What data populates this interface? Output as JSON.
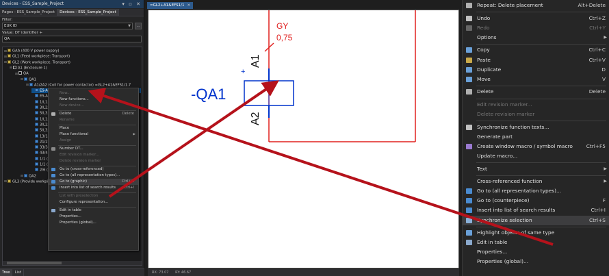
{
  "panel": {
    "title": "Devices - ESS_Sample_Project",
    "tabs": [
      "Pages - ESS_Sample_Project",
      "Devices - ESS_Sample_Project"
    ],
    "filter_label": "Filter:",
    "filter_value": "EUK ID",
    "value_label": "Value: DT identifier +",
    "search_value": "QA",
    "bottom_tabs": [
      "Tree",
      "List"
    ]
  },
  "tree": [
    {
      "text": "GAA (400 V power supply)",
      "indent": 0,
      "icon": "yellow"
    },
    {
      "text": "GL1 (Feed workpiece: Transport)",
      "indent": 0,
      "icon": "yellow"
    },
    {
      "text": "GL2 (Work workpiece: Transport)",
      "indent": 0,
      "icon": "yellow"
    },
    {
      "text": "A1 (Enclosure 1)",
      "indent": 1,
      "icon": "box"
    },
    {
      "text": "QA",
      "indent": 2,
      "icon": "box"
    },
    {
      "text": "QA1",
      "indent": 3,
      "icon": "blue"
    },
    {
      "text": "A1/2A2 (Coil for power contactor) =GL2+A1&EFS1/1.7",
      "indent": 4,
      "icon": "blue"
    },
    {
      "text": "ES-A1",
      "indent": 5,
      "icon": "blue",
      "selected": true
    },
    {
      "text": "ES-A2",
      "indent": 5,
      "icon": "blue"
    },
    {
      "text": "1/L1;",
      "indent": 5,
      "icon": "blue"
    },
    {
      "text": "3/L2;",
      "indent": 5,
      "icon": "blue"
    },
    {
      "text": "5/L3;",
      "indent": 5,
      "icon": "blue"
    },
    {
      "text": "1/L1;4/",
      "indent": 5,
      "icon": "blue"
    },
    {
      "text": "3/L2;4/",
      "indent": 5,
      "icon": "blue"
    },
    {
      "text": "5/L3;6/",
      "indent": 5,
      "icon": "blue"
    },
    {
      "text": "13/14 (",
      "indent": 5,
      "icon": "blue"
    },
    {
      "text": "21/22 (",
      "indent": 5,
      "icon": "blue"
    },
    {
      "text": "33/34 (",
      "indent": 5,
      "icon": "blue"
    },
    {
      "text": "43/44 (",
      "indent": 5,
      "icon": "blue"
    },
    {
      "text": "1/1 (Ma",
      "indent": 5,
      "icon": "blue"
    },
    {
      "text": "1/1 (M",
      "indent": 5,
      "icon": "blue"
    },
    {
      "text": "2/6 (Ma",
      "indent": 5,
      "icon": "blue"
    },
    {
      "text": "QA2",
      "indent": 3,
      "icon": "blue"
    },
    {
      "text": "GL3 (Provide workpie",
      "indent": 0,
      "icon": "yellow"
    }
  ],
  "small_menu": [
    {
      "label": "New...",
      "disabled": true
    },
    {
      "label": "New functions...",
      "disabled": false
    },
    {
      "label": "New device...",
      "disabled": true
    },
    {
      "sep": true
    },
    {
      "label": "Delete",
      "shortcut": "Delete",
      "icon": "trash"
    },
    {
      "label": "Rename",
      "disabled": true
    },
    {
      "sep": true
    },
    {
      "label": "Place"
    },
    {
      "label": "Place functional",
      "submenu": true
    },
    {
      "label": "Assign",
      "disabled": true
    },
    {
      "sep": true
    },
    {
      "label": "Number DT...",
      "icon": "num"
    },
    {
      "label": "Edit revision marker...",
      "disabled": true
    },
    {
      "label": "Delete revision marker",
      "disabled": true
    },
    {
      "sep": true
    },
    {
      "label": "Go to (cross-referenced)",
      "icon": "goto"
    },
    {
      "label": "Go to (all representation types)...",
      "icon": "goto"
    },
    {
      "label": "Go to (graphic)",
      "shortcut": "Ctrl+G",
      "icon": "goto",
      "highlight": true
    },
    {
      "label": "Insert into list of search results",
      "shortcut": "Ctrl+I",
      "icon": "list"
    },
    {
      "sep": true
    },
    {
      "label": "List with preselection",
      "disabled": true
    },
    {
      "label": "Configure representation..."
    },
    {
      "sep": true
    },
    {
      "label": "Edit in table",
      "icon": "table"
    },
    {
      "label": "Properties..."
    },
    {
      "label": "Properties (global)..."
    }
  ],
  "doc_tab": "=GL2+A1&EFS1/1",
  "schematic": {
    "device_tag": "-QA1",
    "pin_top": "A1",
    "pin_bottom": "A2",
    "plus_sign": "+",
    "wire_color": "GY",
    "wire_size": "0,75"
  },
  "status": [
    "RX: 73.07",
    "RY: 46.67"
  ],
  "large_menu": [
    {
      "label": "Repeat: Delete placement",
      "shortcut": "Alt+Delete",
      "icon": "repeat"
    },
    {
      "sep": true
    },
    {
      "label": "Undo",
      "shortcut": "Ctrl+Z",
      "icon": "undo"
    },
    {
      "label": "Redo",
      "shortcut": "Ctrl+Y",
      "icon": "redo",
      "disabled": true
    },
    {
      "label": "Options",
      "submenu": true
    },
    {
      "sep": true
    },
    {
      "label": "Copy",
      "shortcut": "Ctrl+C",
      "icon": "copy"
    },
    {
      "label": "Paste",
      "shortcut": "Ctrl+V",
      "icon": "paste"
    },
    {
      "label": "Duplicate",
      "shortcut": "D",
      "icon": "dup"
    },
    {
      "label": "Move",
      "shortcut": "V",
      "icon": "move"
    },
    {
      "sep": true
    },
    {
      "label": "Delete",
      "shortcut": "Delete",
      "icon": "trash"
    },
    {
      "sep": true
    },
    {
      "label": "Edit revision marker...",
      "disabled": true
    },
    {
      "label": "Delete revision marker",
      "disabled": true
    },
    {
      "sep": true
    },
    {
      "label": "Synchronize function texts...",
      "icon": "synctext"
    },
    {
      "label": "Generate part"
    },
    {
      "label": "Create window macro / symbol macro",
      "shortcut": "Ctrl+F5",
      "icon": "macro"
    },
    {
      "label": "Update macro..."
    },
    {
      "sep": true
    },
    {
      "label": "Text",
      "submenu": true
    },
    {
      "sep": true
    },
    {
      "label": "Cross-referenced function",
      "submenu": true
    },
    {
      "label": "Go to (all representation types)...",
      "icon": "goto"
    },
    {
      "label": "Go to (counterpiece)",
      "shortcut": "F",
      "icon": "goto"
    },
    {
      "label": "Insert into list of search results",
      "shortcut": "Ctrl+I",
      "icon": "list"
    },
    {
      "label": "Synchronize selection",
      "shortcut": "Ctrl+S",
      "icon": "sync",
      "highlight": true
    },
    {
      "sep": true
    },
    {
      "label": "Highlight objects of same type",
      "icon": "highlight"
    },
    {
      "label": "Edit in table",
      "icon": "table"
    },
    {
      "label": "Properties..."
    },
    {
      "label": "Properties (global)..."
    }
  ],
  "colors": {
    "accent": "#0e4f89",
    "schematic_blue": "#0033cc",
    "schematic_red": "#e0201f",
    "annotation": "#b5121b"
  }
}
